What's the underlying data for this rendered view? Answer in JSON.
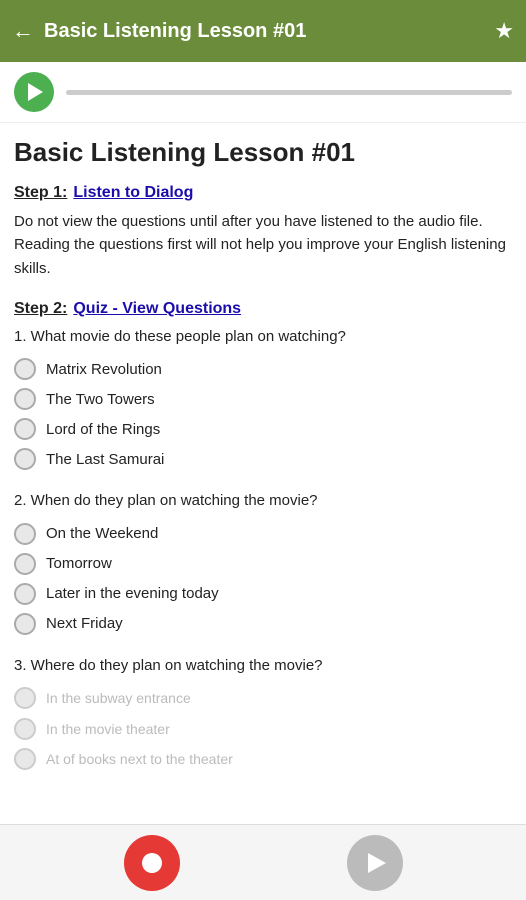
{
  "header": {
    "title": "Basic Listening Lesson #01",
    "back_label": "←",
    "star_label": "★"
  },
  "audio": {
    "progress": 0
  },
  "lesson": {
    "title": "Basic Listening Lesson #01",
    "step1_label": "Step 1:",
    "step1_link": "Listen to Dialog",
    "instruction": "Do not view the questions until after you have listened to the audio file. Reading the questions first will not help you improve your English listening skills.",
    "step2_label": "Step 2:",
    "step2_link": "Quiz - View Questions",
    "questions": [
      {
        "id": 1,
        "text": "1. What movie do these people plan on watching?",
        "options": [
          "Matrix Revolution",
          "The Two Towers",
          "Lord of the Rings",
          "The Last Samurai"
        ]
      },
      {
        "id": 2,
        "text": "2. When do they plan on watching the movie?",
        "options": [
          "On the Weekend",
          "Tomorrow",
          "Later in the evening today",
          "Next Friday"
        ]
      },
      {
        "id": 3,
        "text": "3. Where do they plan on watching the movie?",
        "options": [
          "In the subway entrance",
          "In the movie theater",
          "At of books next to the theater"
        ]
      }
    ]
  },
  "bottom_bar": {
    "record_label": "record",
    "play_label": "play"
  }
}
